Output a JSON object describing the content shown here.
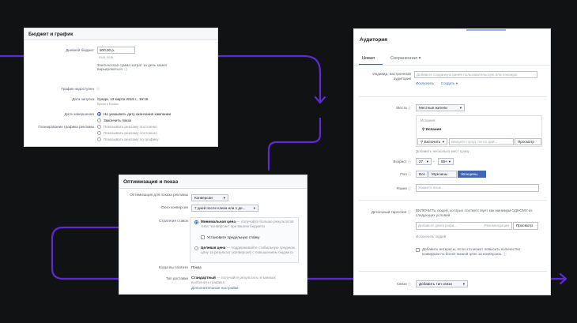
{
  "budget": {
    "title": "Бюджет и график",
    "daily_budget_label": "Дневной бюджет",
    "daily_budget_value": "800,00 р.",
    "currency_note": "RUB, RUB",
    "daily_note": "Фактическая сумма затрат за день может варьироваться.",
    "schedule_label": "График недоступен",
    "start_label": "Дата запуска",
    "start_value": "Среда, 13 марта 2019 г., 19:16",
    "start_tz": "Время в Москве",
    "end_label": "Дата завершения",
    "end_option_1": "Не указывать дату окончания кампании",
    "end_option_2": "Закончить показ",
    "end_option_3": "Показывать рекламу постоянно",
    "plan_label": "Планирование графика рекламы",
    "plan_option_1": "Показывать рекламу постоянно",
    "plan_option_2": "Показывать рекламу по графику"
  },
  "optimization": {
    "title": "Оптимизация и показ",
    "opt_label": "Оптимизация для показа рекламы",
    "opt_value": "Конверсии",
    "window_label": "Окно конверсии",
    "window_value": "7 дней после клика или 1 де...",
    "strategy_label": "Стратегия ставок",
    "strategy_1_title": "Минимальная цена",
    "strategy_1_desc": "— получайте больше результатов типа \"конверсии\" при вашем бюджета",
    "strategy_limit_button": "Установите предельную ставку",
    "strategy_2_title": "Целевая цена",
    "strategy_2_desc": "— поддерживайте стабильную среднюю цену за результат (конверсия) с повышением бюджета",
    "pay_label": "Когда вы платите",
    "pay_value": "Показ",
    "delivery_label": "Тип доставки",
    "delivery_value_title": "Стандартный",
    "delivery_value_desc": "— получайте результаты в заявках выполнить графика",
    "delivery_more": "Дополнительные настройки"
  },
  "audience": {
    "title": "Аудитория",
    "tab_new": "Новая",
    "tab_saved": "Сохраненная",
    "custom_label": "Индивид. настроенная аудитория",
    "custom_placeholder": "Добавьте созданную ранее пользовательскую или похожую",
    "exclude_link": "Исключить",
    "create_link": "Создать",
    "places_label": "Места",
    "places_value": "Местные жители",
    "country_header": "Испания",
    "country_item": "Испания",
    "include_value": "Включить",
    "location_placeholder": "Введите город, почто дай ...",
    "browse_button": "Просмотр",
    "add_many_link": "Добавить несколько мест сразу",
    "age_label": "Возраст",
    "age_from": "27",
    "age_to": "65+",
    "age_dash": "-",
    "gender_label": "Пол",
    "gender_all": "Все",
    "gender_male": "Мужчины",
    "gender_female": "Женщины",
    "lang_label": "Языки",
    "lang_placeholder": "Укажите язык...",
    "detailed_label": "Детальный таргетинг",
    "detailed_desc": "ВКЛЮЧИТЬ людей, которых соответствует как минимум ОДНОМУ из следующих условий",
    "detailed_placeholder": "Добавьте демографи...",
    "recommend_value": "Рекомендации",
    "detailed_browse": "Просмотр",
    "exclude_people_link": "Исключить людей",
    "expand_label": "Добавить интересы, если это может повысить количество конверсии по более низкой цене за конверсию.",
    "connections_label": "Связи",
    "connections_value": "Добавить тип связи"
  },
  "colors": {
    "flow": "#5b2bd6",
    "accent": "#4267b2"
  }
}
